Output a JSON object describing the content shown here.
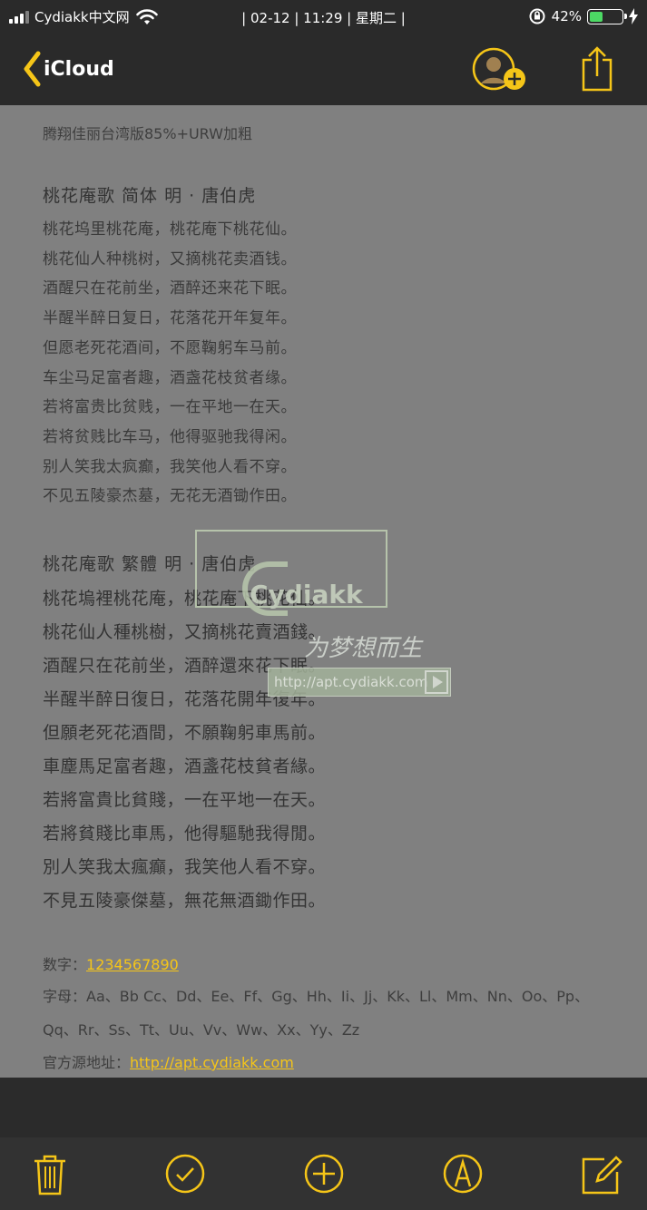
{
  "status_bar": {
    "carrier": "Cydiakk中文网",
    "center": "| 02-12 | 11:29 | 星期二 |",
    "battery_percent": "42%",
    "battery_level": 0.42
  },
  "nav": {
    "back_label": "iCloud"
  },
  "note": {
    "font_line": "腾翔佳丽台湾版85%+URW加粗",
    "simplified_title": "桃花庵歌  简体 明 · 唐伯虎",
    "simplified_lines": [
      "桃花坞里桃花庵，桃花庵下桃花仙。",
      "桃花仙人种桃树，又摘桃花卖酒钱。",
      "酒醒只在花前坐，酒醉还来花下眠。",
      "半醒半醉日复日，花落花开年复年。",
      "但愿老死花酒间，不愿鞠躬车马前。",
      "车尘马足富者趣，酒盏花枝贫者缘。",
      "若将富贵比贫贱，一在平地一在天。",
      "若将贫贱比车马，他得驱驰我得闲。",
      "别人笑我太疯癫，我笑他人看不穿。",
      "不见五陵豪杰墓，无花无酒锄作田。"
    ],
    "traditional_title": "桃花庵歌  繁體 明 · 唐伯虎",
    "traditional_lines": [
      "桃花塢裡桃花庵，桃花庵下桃花仙。",
      "桃花仙人種桃樹，又摘桃花賣酒錢。",
      "酒醒只在花前坐，酒醉還來花下眠。",
      "半醒半醉日復日，花落花開年復年。",
      "但願老死花酒間，不願鞠躬車馬前。",
      "車塵馬足富者趣，酒盞花枝貧者緣。",
      "若將富貴比貧賤，一在平地一在天。",
      "若將貧賤比車馬，他得驅馳我得閒。",
      "別人笑我太瘋癲，我笑他人看不穿。",
      "不見五陵豪傑墓，無花無酒鋤作田。"
    ],
    "digits_label": "数字：",
    "digits_value": "1234567890",
    "letters_line1": "字母：Aa、Bb Cc、Dd、Ee、Ff、Gg、Hh、Ii、Jj、Kk、Ll、Mm、Nn、Oo、Pp、",
    "letters_line2": "Qq、Rr、Ss、Tt、Uu、Vv、Ww、Xx、Yy、Zz",
    "source_label": "官方源地址：",
    "source_url": "http://apt.cydiakk.com"
  },
  "watermark": {
    "brand": "Cydiakk",
    "slogan": "为梦想而生",
    "url": "http://apt.cydiakk.com"
  },
  "toolbar": {
    "icons": [
      "trash-icon",
      "checkmark-circle-icon",
      "plus-circle-icon",
      "markup-pen-icon",
      "compose-icon"
    ]
  },
  "colors": {
    "accent": "#f5c518",
    "note_background": "#808080",
    "chrome": "#2a2a2a"
  }
}
